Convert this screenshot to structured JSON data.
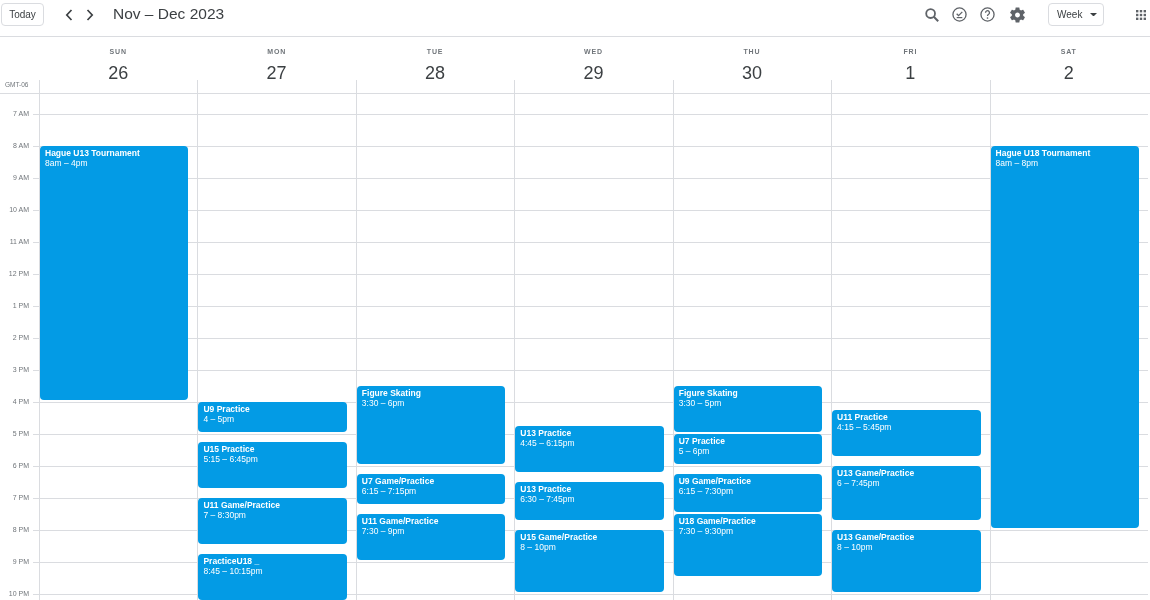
{
  "toolbar": {
    "today_button": "Today",
    "title": "Nov – Dec 2023",
    "view_selector": "Week"
  },
  "timezone": "GMT-06",
  "hours": [
    "7 AM",
    "8 AM",
    "9 AM",
    "10 AM",
    "11 AM",
    "12 PM",
    "1 PM",
    "2 PM",
    "3 PM",
    "4 PM",
    "5 PM",
    "6 PM",
    "7 PM",
    "8 PM",
    "9 PM",
    "10 PM"
  ],
  "days": [
    {
      "weekday": "SUN",
      "date": "26",
      "events": [
        {
          "title": "Hague U13 Tournament",
          "time": "8am – 4pm"
        }
      ]
    },
    {
      "weekday": "MON",
      "date": "27",
      "events": [
        {
          "title": "U9 Practice",
          "time": "4 – 5pm"
        },
        {
          "title": "U15 Practice",
          "time": "5:15 – 6:45pm"
        },
        {
          "title": "U11 Game/Practice",
          "time": "7 – 8:30pm"
        },
        {
          "title": "PracticeU18 _",
          "time": "8:45 – 10:15pm"
        }
      ]
    },
    {
      "weekday": "TUE",
      "date": "28",
      "events": [
        {
          "title": "Figure Skating",
          "time": "3:30 – 6pm"
        },
        {
          "title": "U7 Game/Practice",
          "time": "6:15 – 7:15pm"
        },
        {
          "title": "U11 Game/Practice",
          "time": "7:30 – 9pm"
        }
      ]
    },
    {
      "weekday": "WED",
      "date": "29",
      "events": [
        {
          "title": "U13 Practice",
          "time": "4:45 – 6:15pm"
        },
        {
          "title": "U13 Practice",
          "time": "6:30 – 7:45pm"
        },
        {
          "title": "U15 Game/Practice",
          "time": "8 – 10pm"
        }
      ]
    },
    {
      "weekday": "THU",
      "date": "30",
      "events": [
        {
          "title": "Figure Skating",
          "time": "3:30 – 5pm"
        },
        {
          "title": "U7 Practice",
          "time": "5 – 6pm"
        },
        {
          "title": "U9 Game/Practice",
          "time": "6:15 – 7:30pm"
        },
        {
          "title": "U18 Game/Practice",
          "time": "7:30 – 9:30pm"
        }
      ]
    },
    {
      "weekday": "FRI",
      "date": "1",
      "events": [
        {
          "title": "U11 Practice",
          "time": "4:15 – 5:45pm"
        },
        {
          "title": "U13 Game/Practice",
          "time": "6 – 7:45pm"
        },
        {
          "title": "U13 Game/Practice",
          "time": "8 – 10pm"
        }
      ]
    },
    {
      "weekday": "SAT",
      "date": "2",
      "events": [
        {
          "title": "Hague U18 Tournament",
          "time": "8am – 8pm"
        }
      ]
    }
  ]
}
